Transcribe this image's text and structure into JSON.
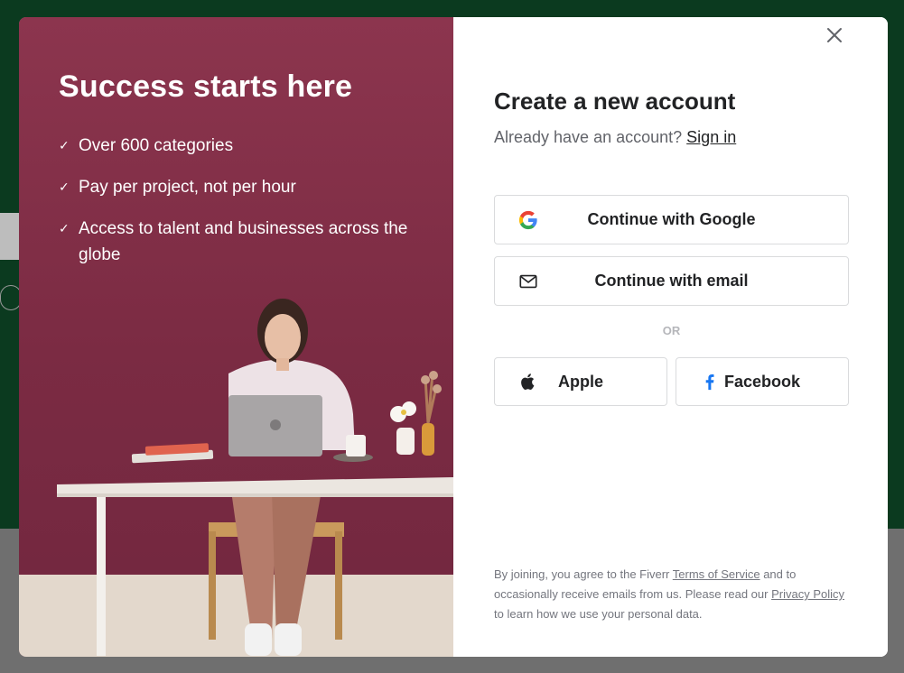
{
  "left_panel": {
    "headline": "Success starts here",
    "benefits": [
      "Over 600 categories",
      "Pay per project, not per hour",
      "Access to talent and businesses across the globe"
    ]
  },
  "form": {
    "title": "Create a new account",
    "have_account_text": "Already have an account?",
    "sign_in_link": "Sign in",
    "google_button": "Continue with Google",
    "email_button": "Continue with email",
    "divider": "OR",
    "apple_button": "Apple",
    "facebook_button": "Facebook"
  },
  "legal": {
    "prefix": "By joining, you agree to the Fiverr ",
    "terms_link": "Terms of Service",
    "middle": " and to occasionally receive emails from us. Please read our ",
    "privacy_link": "Privacy Policy",
    "suffix": " to learn how we use your personal data."
  },
  "colors": {
    "panel_background": "#7d2e45",
    "google_blue": "#4285F4",
    "google_red": "#EA4335",
    "google_yellow": "#FBBC05",
    "google_green": "#34A853",
    "facebook_blue": "#1877F2"
  },
  "icons": {
    "close": "close-icon",
    "google": "google-icon",
    "email": "envelope-icon",
    "apple": "apple-icon",
    "facebook": "facebook-icon",
    "check": "check-icon"
  }
}
